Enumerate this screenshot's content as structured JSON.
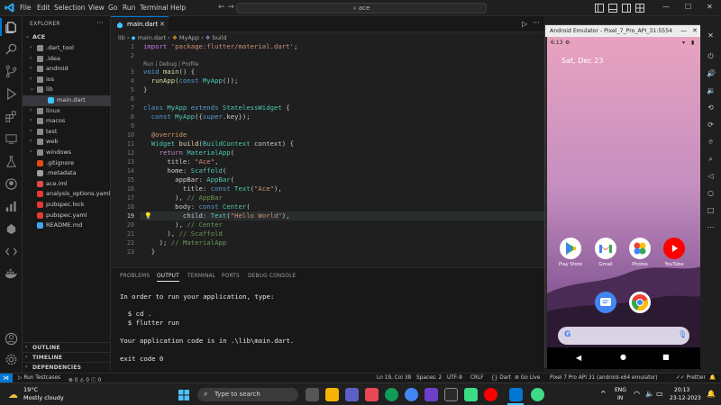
{
  "menu": [
    "File",
    "Edit",
    "Selection",
    "View",
    "Go",
    "Run",
    "Terminal",
    "Help"
  ],
  "search": {
    "placeholder": "ace"
  },
  "explorer": {
    "header": "EXPLORER",
    "root": "ACE",
    "items": [
      {
        "label": ".dart_tool",
        "type": "folder"
      },
      {
        "label": ".idea",
        "type": "folder"
      },
      {
        "label": "android",
        "type": "folder"
      },
      {
        "label": "ios",
        "type": "folder"
      },
      {
        "label": "lib",
        "type": "folder-open"
      },
      {
        "label": "main.dart",
        "type": "dart"
      },
      {
        "label": "linux",
        "type": "folder"
      },
      {
        "label": "macos",
        "type": "folder"
      },
      {
        "label": "test",
        "type": "folder"
      },
      {
        "label": "web",
        "type": "folder"
      },
      {
        "label": "windows",
        "type": "folder"
      },
      {
        "label": ".gitignore",
        "type": "git"
      },
      {
        "label": ".metadata",
        "type": "file"
      },
      {
        "label": "ace.iml",
        "type": "iml"
      },
      {
        "label": "analysis_options.yaml",
        "type": "yaml"
      },
      {
        "label": "pubspec.lock",
        "type": "yaml"
      },
      {
        "label": "pubspec.yaml",
        "type": "yaml"
      },
      {
        "label": "README.md",
        "type": "md"
      }
    ],
    "sections": [
      "OUTLINE",
      "TIMELINE",
      "DEPENDENCIES"
    ]
  },
  "editor": {
    "tab": "main.dart",
    "breadcrumb": {
      "a": "lib",
      "b": "main.dart",
      "c": "MyApp",
      "d": "build"
    },
    "codelens": "Run | Debug | Profile",
    "lines": {
      "n1": "1",
      "n2": "2",
      "n3": "3",
      "n4": "4",
      "n5": "5",
      "n6": "6",
      "n7": "7",
      "n8": "8",
      "n9": "9",
      "n10": "10",
      "n11": "11",
      "n12": "12",
      "n13": "13",
      "n14": "14",
      "n15": "15",
      "n16": "16",
      "n17": "17",
      "n18": "18",
      "n19": "19",
      "n20": "20",
      "n21": "21",
      "n22": "22",
      "n23": "23"
    },
    "code": {
      "l1a": "import ",
      "l1b": "'package:flutter/material.dart'",
      "l1c": ";",
      "l3a": "void ",
      "l3b": "main",
      "l3c": "() {",
      "l4a": "  runApp(",
      "l4b": "const ",
      "l4c": "MyApp",
      "l4d": "());",
      "l5": "}",
      "l7a": "class ",
      "l7b": "MyApp ",
      "l7c": "extends ",
      "l7d": "StatelessWidget",
      "l7e": " {",
      "l8a": "  const ",
      "l8b": "MyApp",
      "l8c": "({",
      "l8d": "super",
      "l8e": ".key});",
      "l10": "  @override",
      "l11a": "  Widget ",
      "l11b": "build",
      "l11c": "(",
      "l11d": "BuildContext",
      "l11e": " context) {",
      "l12a": "    return ",
      "l12b": "MaterialApp",
      "l12c": "(",
      "l13a": "      title: ",
      "l13b": "\"Ace\"",
      "l13c": ",",
      "l14a": "      home: ",
      "l14b": "Scaffold",
      "l14c": "(",
      "l15a": "        appBar: ",
      "l15b": "AppBar",
      "l15c": "(",
      "l16a": "          title: ",
      "l16b": "const ",
      "l16c": "Text",
      "l16d": "(",
      "l16e": "\"Ace\"",
      "l16f": "),",
      "l17a": "        ), ",
      "l17b": "// AppBar",
      "l18a": "        body: ",
      "l18b": "const ",
      "l18c": "Center",
      "l18d": "(",
      "l19a": "          child: ",
      "l19b": "Text",
      "l19c": "(",
      "l19d": "\"Hello World\"",
      "l19e": "),",
      "l20a": "        ), ",
      "l20b": "// Center",
      "l21a": "      ), ",
      "l21b": "// Scaffold",
      "l22a": "    ); ",
      "l22b": "// MaterialApp",
      "l23": "  }"
    }
  },
  "panel": {
    "tabs": [
      "PROBLEMS",
      "OUTPUT",
      "TERMINAL",
      "PORTS",
      "DEBUG CONSOLE"
    ],
    "output": {
      "line1": "In order to run your application, type:",
      "line2": "  $ cd .",
      "line3": "  $ flutter run",
      "line4": "Your application code is in .\\lib\\main.dart.",
      "line5": "exit code 0"
    }
  },
  "status": {
    "testcases": "Run Testcases",
    "errors": "0",
    "warnings": "0",
    "info": "0",
    "position": "Ln 19, Col 38",
    "spaces": "Spaces: 2",
    "encoding": "UTF-8",
    "eol": "CRLF",
    "language": "Dart",
    "golive": "Go Live",
    "device": "Pixel 7 Pro API 31 (android-x64 emulator)",
    "prettier": "Prettier"
  },
  "emulator": {
    "title": "Android Emulator - Pixel_7_Pro_API_31:5554",
    "time": "6:13",
    "date": "Sat, Dec 23",
    "apps": [
      {
        "label": "Play Store",
        "color": "#ffffff"
      },
      {
        "label": "Gmail",
        "color": "#ffffff"
      },
      {
        "label": "Photos",
        "color": "#ffffff"
      },
      {
        "label": "YouTube",
        "color": "#ff0000"
      }
    ]
  },
  "taskbar": {
    "temp": "19°C",
    "weather": "Mostly cloudy",
    "search": "Type to search",
    "lang1": "ENG",
    "lang2": "IN",
    "time": "20:13",
    "date": "23-12-2023"
  },
  "colors": {
    "accent": "#0078d4",
    "editor_bg": "#1f1f1f",
    "sidebar_bg": "#181818"
  }
}
